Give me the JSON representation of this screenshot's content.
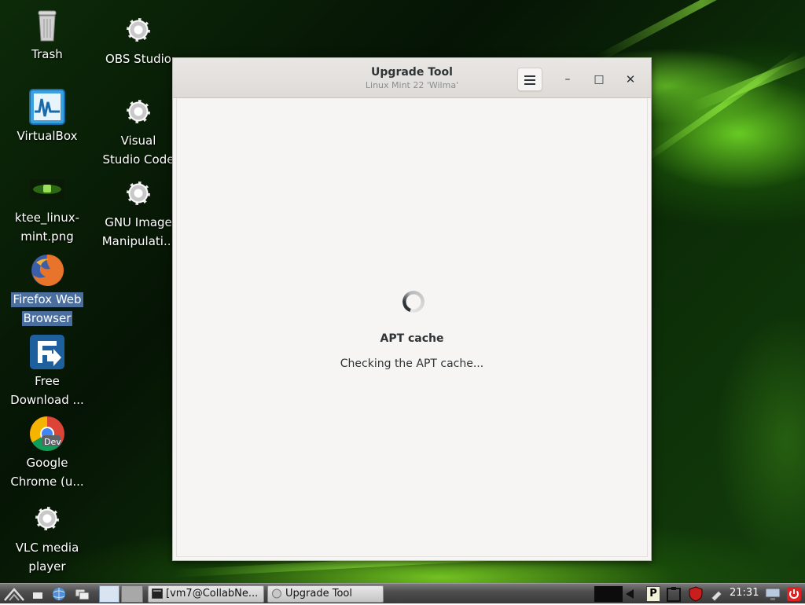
{
  "desktop": {
    "icons": [
      {
        "label": "Trash",
        "icon": "trash-icon"
      },
      {
        "label": "OBS Studio",
        "icon": "gear-icon"
      },
      {
        "label": "VirtualBox",
        "icon": "virtualbox-icon"
      },
      {
        "label": "Visual",
        "label2": "Studio Code",
        "icon": "gear-icon"
      },
      {
        "label": "ktee_linux-",
        "label2": "mint.png",
        "icon": "image-thumbnail-icon"
      },
      {
        "label": "GNU Image",
        "label2": "Manipulati...",
        "icon": "gear-icon"
      },
      {
        "label": "Firefox Web",
        "label2": "Browser",
        "icon": "firefox-icon"
      },
      {
        "label": "Free",
        "label2": "Download ...",
        "icon": "free-download-manager-icon"
      },
      {
        "label": "Google",
        "label2": "Chrome (u...",
        "icon": "chrome-dev-icon",
        "badge": "Dev"
      },
      {
        "label": "VLC media",
        "label2": "player",
        "icon": "gear-icon"
      }
    ]
  },
  "window": {
    "title": "Upgrade Tool",
    "subtitle": "Linux Mint 22 'Wilma'",
    "minimize_glyph": "–",
    "maximize_glyph": "□",
    "close_glyph": "✕",
    "content": {
      "heading": "APT cache",
      "status": "Checking the APT cache..."
    }
  },
  "taskbar": {
    "tasks": [
      {
        "label": "[vm7@CollabNe..."
      },
      {
        "label": "Upgrade Tool"
      }
    ],
    "clock": "21:31",
    "tray_badge": "P"
  },
  "colors": {
    "window_bg": "#f6f5f4",
    "text": "#2e3436",
    "selection": "#4a6f9f"
  }
}
